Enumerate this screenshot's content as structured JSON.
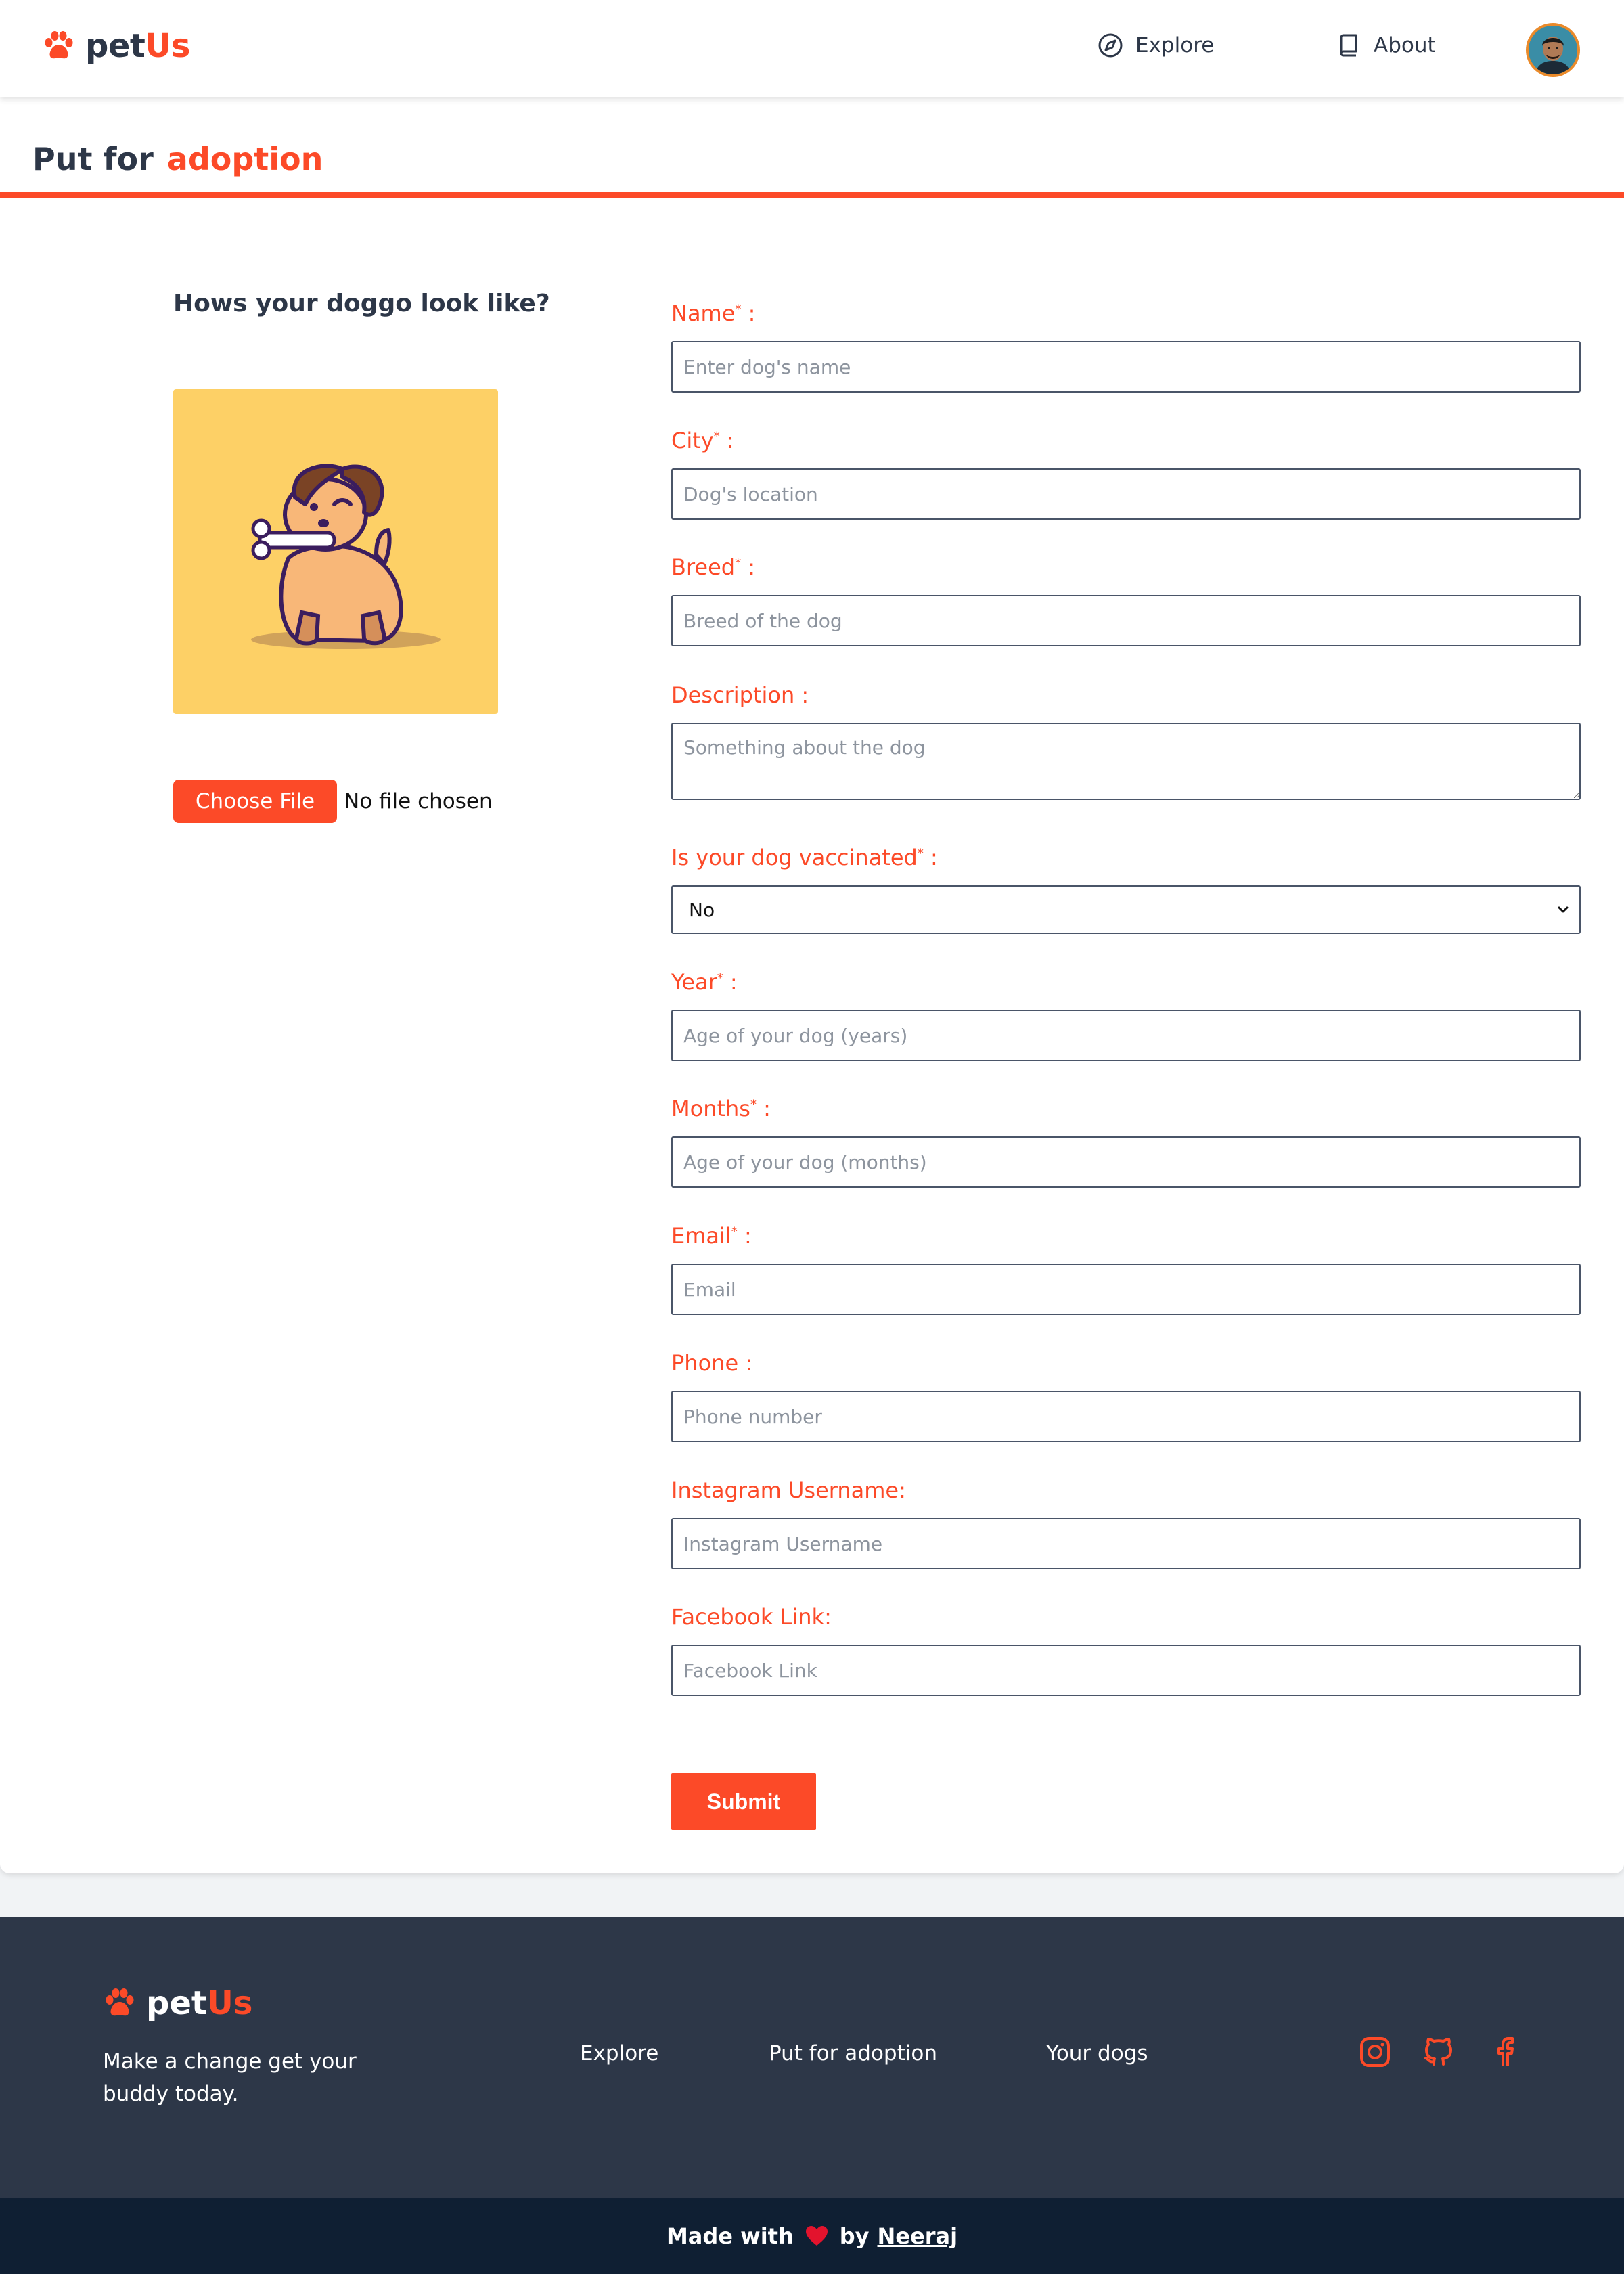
{
  "brand": {
    "name_prefix": "pet",
    "name_accent": "Us",
    "accent_color": "#fc4a28",
    "dark_color": "#2d3748"
  },
  "header": {
    "nav": [
      {
        "label": "Explore",
        "icon": "compass-icon"
      },
      {
        "label": "About",
        "icon": "book-icon"
      }
    ],
    "avatar": "user-avatar"
  },
  "page": {
    "title_prefix": "Put for",
    "title_accent": "adoption"
  },
  "upload": {
    "heading": "Hows your doggo look like?",
    "button_label": "Choose File",
    "status": "No file chosen",
    "preview_bg": "#fdd066"
  },
  "form": {
    "name": {
      "label": "Name",
      "req": "*",
      "suffix": " :",
      "placeholder": "Enter dog's name"
    },
    "city": {
      "label": "City",
      "req": "*",
      "suffix": " :",
      "placeholder": "Dog's location"
    },
    "breed": {
      "label": "Breed",
      "req": "*",
      "suffix": " :",
      "placeholder": "Breed of the dog"
    },
    "description": {
      "label": "Description :",
      "placeholder": "Something about the dog"
    },
    "vaccinated": {
      "label": "Is your dog vaccinated",
      "req": "*",
      "suffix": " :",
      "value": "No"
    },
    "year": {
      "label": "Year",
      "req": "*",
      "suffix": " :",
      "placeholder": "Age of your dog (years)"
    },
    "months": {
      "label": "Months",
      "req": "*",
      "suffix": " :",
      "placeholder": "Age of your dog (months)"
    },
    "email": {
      "label": "Email",
      "req": "*",
      "suffix": " :",
      "placeholder": "Email"
    },
    "phone": {
      "label": "Phone :",
      "placeholder": "Phone number"
    },
    "instagram": {
      "label": "Instagram Username:",
      "placeholder": "Instagram Username"
    },
    "facebook": {
      "label": "Facebook Link:",
      "placeholder": "Facebook Link"
    },
    "submit_label": "Submit"
  },
  "footer": {
    "tagline": "Make a change get your buddy today.",
    "links": [
      "Explore",
      "Put for adoption",
      "Your dogs"
    ],
    "social": [
      "instagram-icon",
      "github-icon",
      "facebook-icon"
    ],
    "credit_prefix": "Made with",
    "credit_by": "by",
    "credit_author": "Neeraj"
  }
}
